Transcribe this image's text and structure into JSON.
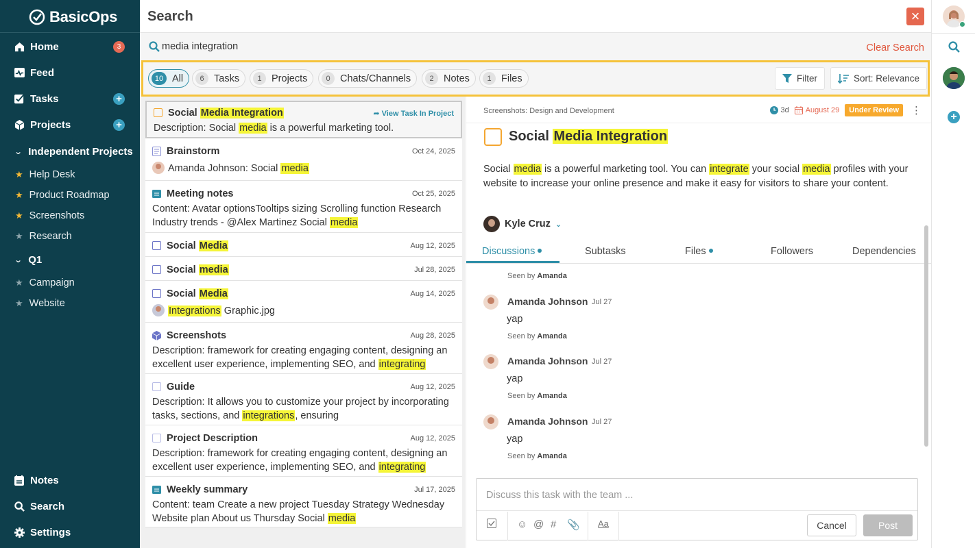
{
  "sidebar": {
    "logo": "BasicOps",
    "nav": [
      {
        "label": "Home",
        "badge": "3"
      },
      {
        "label": "Feed"
      },
      {
        "label": "Tasks"
      },
      {
        "label": "Projects"
      }
    ],
    "section_independent": "Independent Projects",
    "independent_projects": [
      {
        "label": "Help Desk",
        "starred": true
      },
      {
        "label": "Product Roadmap",
        "starred": true
      },
      {
        "label": "Screenshots",
        "starred": true
      },
      {
        "label": "Research",
        "starred": false
      }
    ],
    "section_q1": "Q1",
    "q1_projects": [
      {
        "label": "Campaign"
      },
      {
        "label": "Website"
      }
    ],
    "bottom": [
      {
        "label": "Notes"
      },
      {
        "label": "Search"
      },
      {
        "label": "Settings"
      }
    ]
  },
  "header": {
    "title": "Search"
  },
  "search": {
    "query": "media integration",
    "clear": "Clear Search"
  },
  "filters": {
    "chips": [
      {
        "count": "10",
        "label": "All"
      },
      {
        "count": "6",
        "label": "Tasks"
      },
      {
        "count": "1",
        "label": "Projects"
      },
      {
        "count": "0",
        "label": "Chats/Channels"
      },
      {
        "count": "2",
        "label": "Notes"
      },
      {
        "count": "1",
        "label": "Files"
      }
    ],
    "filter_label": "Filter",
    "sort_label": "Sort: Relevance"
  },
  "results": {
    "r0": {
      "title_a": "Social ",
      "title_hl": "Media Integration",
      "link": "View Task In Project",
      "desc_a": "Description: Social ",
      "desc_hl": "media",
      "desc_b": " is a powerful marketing tool."
    },
    "r1": {
      "title": "Brainstorm",
      "date": "Oct 24, 2025",
      "desc_a": "Amanda Johnson:  Social ",
      "desc_hl": "media"
    },
    "r2": {
      "title": "Meeting notes",
      "date": "Oct 25, 2025",
      "desc_a": "Content: Avatar optionsTooltips sizing Scrolling function Research Industry trends - @Alex Martinez Social ",
      "desc_hl": "media"
    },
    "r3": {
      "title_a": "Social ",
      "title_hl": "Media",
      "date": "Aug 12, 2025"
    },
    "r4": {
      "title_a": "Social ",
      "title_hl": "media",
      "date": "Jul 28, 2025"
    },
    "r5": {
      "title_a": "Social ",
      "title_hl": "Media",
      "date": "Aug 14, 2025",
      "file_hl": "Integrations",
      "file_b": " Graphic.jpg"
    },
    "r6": {
      "title": "Screenshots",
      "date": "Aug 28, 2025",
      "desc_a": "Description: framework for creating engaging content, designing an excellent user experience, implementing SEO, and ",
      "desc_hl": "integrating"
    },
    "r7": {
      "title": "Guide",
      "date": "Aug 12, 2025",
      "desc_a": "Description: It allows you to customize your project by incorporating tasks, sections, and ",
      "desc_hl": "integrations",
      "desc_b": ", ensuring"
    },
    "r8": {
      "title": "Project Description",
      "date": "Aug 12, 2025",
      "desc_a": "Description: framework for creating engaging content, designing an excellent user experience, implementing SEO, and ",
      "desc_hl": "integrating"
    },
    "r9": {
      "title": "Weekly summary",
      "date": "Jul 17, 2025",
      "desc_a": "Content: team Create a new project Tuesday Strategy Wednesday Website plan About us Thursday Social ",
      "desc_hl": "media"
    }
  },
  "detail": {
    "breadcrumb": "Screenshots: Design and Development",
    "time": "3d",
    "due": "August 29",
    "status": "Under Review",
    "title_a": "Social ",
    "title_hl": "Media Integration",
    "desc": [
      "Social ",
      "media",
      " is a powerful marketing tool. You can ",
      "integrate",
      " your social ",
      "media",
      " profiles with your website to increase your online presence and make it easy for visitors to share your content."
    ],
    "assignee": "Kyle Cruz",
    "tabs": [
      "Discussions",
      "Subtasks",
      "Files",
      "Followers",
      "Dependencies"
    ],
    "seen_prefix": "Seen by ",
    "seen_name": "Amanda",
    "messages": [
      {
        "author": "Amanda Johnson",
        "date": "Jul 27",
        "text": "yap"
      },
      {
        "author": "Amanda Johnson",
        "date": "Jul 27",
        "text": "yap"
      },
      {
        "author": "Amanda Johnson",
        "date": "Jul 27",
        "text": "yap"
      }
    ],
    "composer_placeholder": "Discuss this task with the team ...",
    "cancel": "Cancel",
    "post": "Post"
  },
  "colors": {
    "sidebar": "#0e3f4c",
    "accent": "#2f8fa8",
    "highlight": "#f5f538",
    "danger": "#e5674f",
    "status": "#f7a92d",
    "focus_border": "#f5c23a"
  }
}
